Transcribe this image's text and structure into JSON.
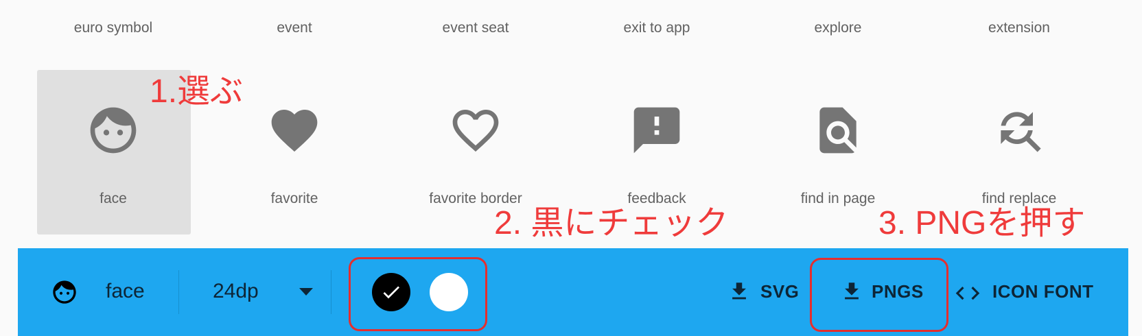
{
  "top_labels": [
    "euro symbol",
    "event",
    "event seat",
    "exit to app",
    "explore",
    "extension"
  ],
  "icons": [
    {
      "label": "face",
      "icon": "face-icon",
      "selected": true
    },
    {
      "label": "favorite",
      "icon": "heart-icon"
    },
    {
      "label": "favorite border",
      "icon": "heart-outline-icon"
    },
    {
      "label": "feedback",
      "icon": "feedback-icon"
    },
    {
      "label": "find in page",
      "icon": "find-in-page-icon"
    },
    {
      "label": "find replace",
      "icon": "find-replace-icon"
    }
  ],
  "annotations": [
    "1.選ぶ",
    "2. 黒にチェック",
    "3. PNGを押す"
  ],
  "bottom_bar": {
    "icon_name": "face",
    "size": "24dp",
    "svg_label": "SVG",
    "pngs_label": "PNGS",
    "icon_font_label": "ICON FONT"
  },
  "colors": {
    "bar": "#1ea7f0",
    "annotation": "#ef3b3b",
    "icon_gray": "#757575",
    "selected_bg": "#e0e0e0"
  }
}
